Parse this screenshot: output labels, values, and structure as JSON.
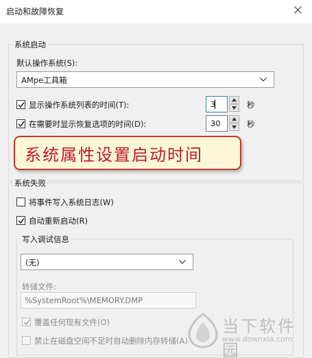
{
  "window": {
    "title": "启动和故障恢复"
  },
  "system_startup": {
    "group_label": "系统启动",
    "default_os_label": "默认操作系统(S):",
    "default_os_value": "AMpe工具箱",
    "show_os_list": {
      "label": "显示操作系统列表的时间(T):",
      "checked": true,
      "value": "3",
      "unit": "秒"
    },
    "show_recovery": {
      "label": "在需要时显示恢复选项的时间(D):",
      "checked": true,
      "value": "30",
      "unit": "秒"
    }
  },
  "overlay": {
    "text": "系统属性设置启动时间"
  },
  "system_failure": {
    "group_label": "系统失败",
    "write_event_log": {
      "label": "将事件写入系统日志(W)",
      "checked": false
    },
    "auto_restart": {
      "label": "自动重新启动(R)",
      "checked": true
    },
    "debug_info": {
      "group_label": "写入调试信息",
      "dropdown_value": "(无)",
      "dump_file_label": "转储文件:",
      "dump_file_value": "%SystemRoot%\\MEMORY.DMP",
      "overwrite": {
        "label": "覆盖任何现有文件(O)",
        "checked": true
      },
      "disable_auto_delete": {
        "label": "禁止在磁盘空间不足时自动删除内存转储(A)",
        "checked": false
      }
    }
  },
  "watermark": {
    "text": "当下软件园",
    "url": "www.downxia.com"
  },
  "colors": {
    "overlay_border": "#c0392b",
    "overlay_text": "#c0192b",
    "overlay_bg": "#fbf7d8",
    "dialog_bg": "#f0f0f0"
  }
}
